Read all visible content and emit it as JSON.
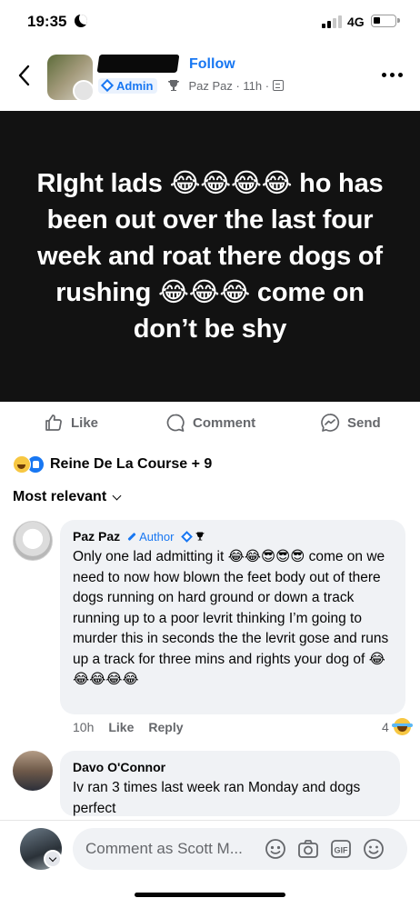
{
  "status_bar": {
    "time": "19:35",
    "network": "4G"
  },
  "post_header": {
    "follow_label": "Follow",
    "admin_label": "Admin",
    "meta": "Paz Paz · 11h ·"
  },
  "post": {
    "text": "RIght lads 😂😂😂😂 ho has been out over the last four week and roat there dogs of rushing 😂😂😂 come on don’t be shy",
    "background_color": "#121212"
  },
  "actions": {
    "like": "Like",
    "comment": "Comment",
    "send": "Send"
  },
  "reactions": {
    "summary": "Reine De La Course + 9"
  },
  "sort": {
    "label": "Most relevant"
  },
  "comments": [
    {
      "author": "Paz Paz",
      "tag": "Author",
      "text": "Only one lad admitting it 😂😂😎😎😎 come on we need to now how blown the feet body out of there dogs running on hard ground or down a track running up to a poor levrit thinking I’m going to murder this in seconds the the levrit gose and runs up a track for three mins and rights your dog of 😂😂😂😂😂",
      "time": "10h",
      "like": "Like",
      "reply": "Reply",
      "reaction_count": "4"
    },
    {
      "author": "Davo O'Connor",
      "text": "Iv ran 3 times last week ran Monday and dogs perfect"
    }
  ],
  "composer": {
    "placeholder": "Comment as Scott M..."
  },
  "colors": {
    "accent": "#1877f2",
    "secondary_text": "#65676b",
    "bubble": "#f0f2f5"
  }
}
